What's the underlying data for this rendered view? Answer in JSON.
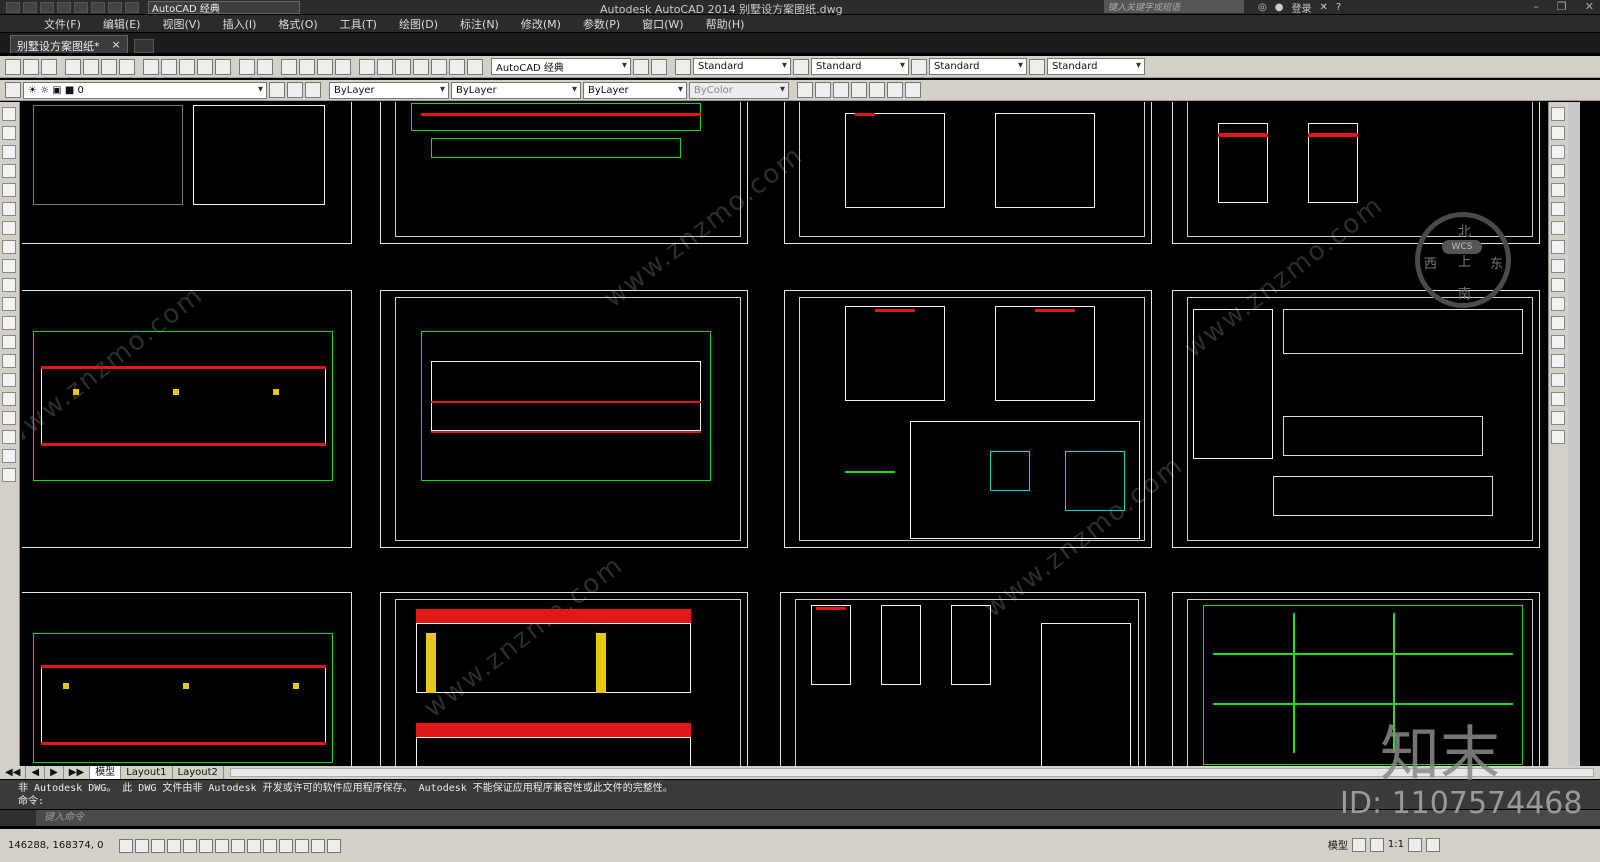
{
  "app": {
    "title": "Autodesk AutoCAD 2014    别墅设方案图纸.dwg",
    "workspace": "AutoCAD 经典",
    "search_placeholder": "键入关键字或短语",
    "login": "登录"
  },
  "menu": [
    "文件(F)",
    "编辑(E)",
    "视图(V)",
    "插入(I)",
    "格式(O)",
    "工具(T)",
    "绘图(D)",
    "标注(N)",
    "修改(M)",
    "参数(P)",
    "窗口(W)",
    "帮助(H)"
  ],
  "document_tab": {
    "label": "别墅设方案图纸*",
    "close": "×"
  },
  "toolbar": {
    "workspace_combo": "AutoCAD 经典",
    "text_style": "Standard",
    "dim_style": "Standard",
    "table_style": "Standard",
    "multileader_style": "Standard"
  },
  "properties": {
    "layer": "0",
    "color": "ByLayer",
    "linetype": "ByLayer",
    "lineweight": "ByLayer",
    "plotstyle": "ByColor"
  },
  "viewcube": {
    "north": "北",
    "south": "南",
    "east": "东",
    "west": "西",
    "center": "上",
    "wcs": "WCS"
  },
  "layout_tabs": [
    "模型",
    "Layout1",
    "Layout2"
  ],
  "command": {
    "history_line1": "非 Autodesk DWG。  此 DWG 文件由非 Autodesk 开发或许可的软件应用程序保存。  Autodesk 不能保证应用程序兼容性或此文件的完整性。",
    "history_line2": "命令:",
    "input_placeholder": "键入命令"
  },
  "status": {
    "coordinates": "146288, 168374, 0",
    "model": "模型",
    "scale": "1:1"
  },
  "watermark": {
    "site": "www.znzmo.com",
    "brand": "知末",
    "id": "ID: 1107574468"
  },
  "colors": {
    "canvas": "#000000",
    "drawing_green": "#1fd11f",
    "drawing_red": "#e01818",
    "drawing_yellow": "#e6c814",
    "toolbar_bg": "#d4d0c8"
  }
}
